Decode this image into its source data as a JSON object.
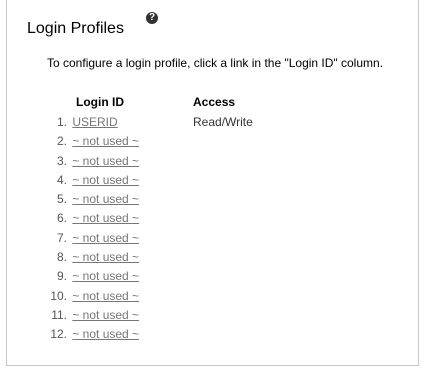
{
  "header": {
    "title": "Login Profiles",
    "help_icon": "question-circle-icon"
  },
  "intro": "To configure a login profile, click a link in the \"Login ID\" column.",
  "table": {
    "columns": [
      "Login ID",
      "Access"
    ],
    "rows": [
      {
        "num": "1.",
        "login_id": "USERID",
        "access": "Read/Write"
      },
      {
        "num": "2.",
        "login_id": "~ not used ~",
        "access": ""
      },
      {
        "num": "3.",
        "login_id": "~ not used ~",
        "access": ""
      },
      {
        "num": "4.",
        "login_id": "~ not used ~",
        "access": ""
      },
      {
        "num": "5.",
        "login_id": "~ not used ~",
        "access": ""
      },
      {
        "num": "6.",
        "login_id": "~ not used ~",
        "access": ""
      },
      {
        "num": "7.",
        "login_id": "~ not used ~",
        "access": ""
      },
      {
        "num": "8.",
        "login_id": "~ not used ~",
        "access": ""
      },
      {
        "num": "9.",
        "login_id": "~ not used ~",
        "access": ""
      },
      {
        "num": "10.",
        "login_id": "~ not used ~",
        "access": ""
      },
      {
        "num": "11.",
        "login_id": "~ not used ~",
        "access": ""
      },
      {
        "num": "12.",
        "login_id": "~ not used ~",
        "access": ""
      }
    ]
  },
  "colors": {
    "link": "#777777",
    "panel_border": "#c8c8c8"
  }
}
